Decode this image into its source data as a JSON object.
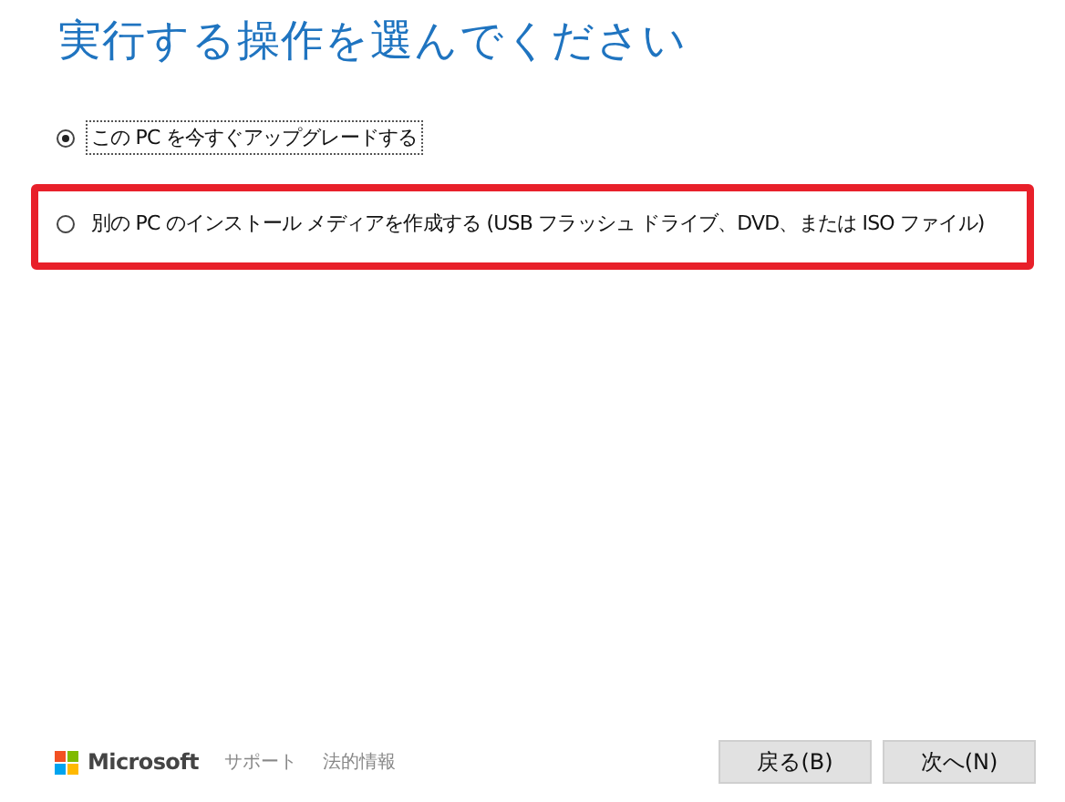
{
  "title": "実行する操作を選んでください",
  "options": [
    {
      "label": "この PC を今すぐアップグレードする",
      "selected": true,
      "focused": true,
      "highlighted": false
    },
    {
      "label": "別の PC のインストール メディアを作成する (USB フラッシュ ドライブ、DVD、または ISO ファイル)",
      "selected": false,
      "focused": false,
      "highlighted": true
    }
  ],
  "footer": {
    "brand": "Microsoft",
    "links": [
      "サポート",
      "法的情報"
    ]
  },
  "buttons": [
    "戻る(B)",
    "次へ(N)"
  ]
}
